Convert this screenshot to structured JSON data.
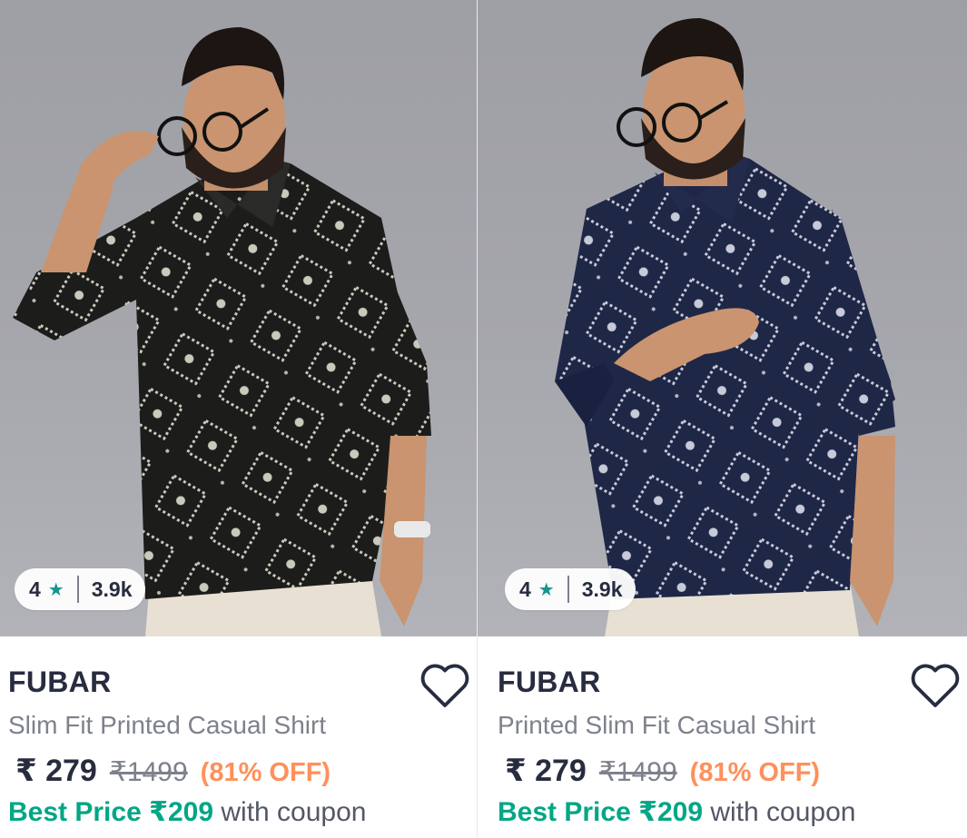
{
  "products": [
    {
      "rating": "4",
      "rating_count": "3.9k",
      "brand": "FUBAR",
      "title": "Slim Fit Printed Casual Shirt",
      "price": "₹ 279",
      "mrp": "₹1499",
      "discount": "(81% OFF)",
      "best_price_label": "Best Price ₹209",
      "coupon_text": "with coupon",
      "shirt_color": "#1c1d1b"
    },
    {
      "rating": "4",
      "rating_count": "3.9k",
      "brand": "FUBAR",
      "title": "Printed Slim Fit Casual Shirt",
      "price": "₹ 279",
      "mrp": "₹1499",
      "discount": "(81% OFF)",
      "best_price_label": "Best Price ₹209",
      "coupon_text": "with coupon",
      "shirt_color": "#1f2747"
    }
  ],
  "icons": {
    "rating": "star-icon",
    "wishlist": "heart-outline-icon"
  },
  "colors": {
    "rating_star": "#14958f",
    "discount": "#ff905a",
    "best_price": "#03a685"
  }
}
